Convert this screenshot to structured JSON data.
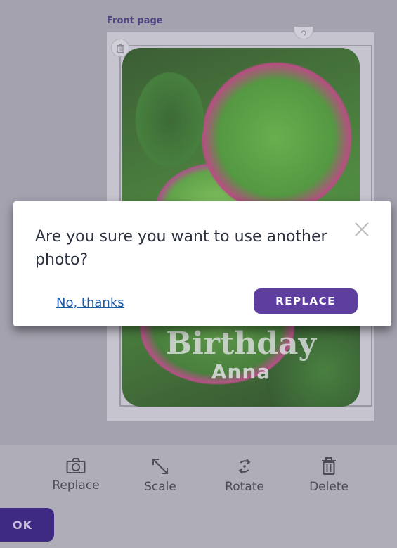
{
  "editor": {
    "page_label": "Front page",
    "card": {
      "title_text": "Birthday",
      "name_text": "Anna"
    }
  },
  "toolbar": {
    "tools": [
      {
        "label": "Replace",
        "icon": "camera-icon"
      },
      {
        "label": "Scale",
        "icon": "scale-icon"
      },
      {
        "label": "Rotate",
        "icon": "rotate-icon"
      },
      {
        "label": "Delete",
        "icon": "trash-icon"
      }
    ],
    "ok_label": "OK"
  },
  "modal": {
    "message": "Are you sure you want to use another photo?",
    "no_label": "No, thanks",
    "replace_label": "REPLACE",
    "close_icon": "close-icon"
  },
  "colors": {
    "accent": "#5e3f9f",
    "ok_button": "#3f2a83",
    "link": "#1f5aa6"
  }
}
